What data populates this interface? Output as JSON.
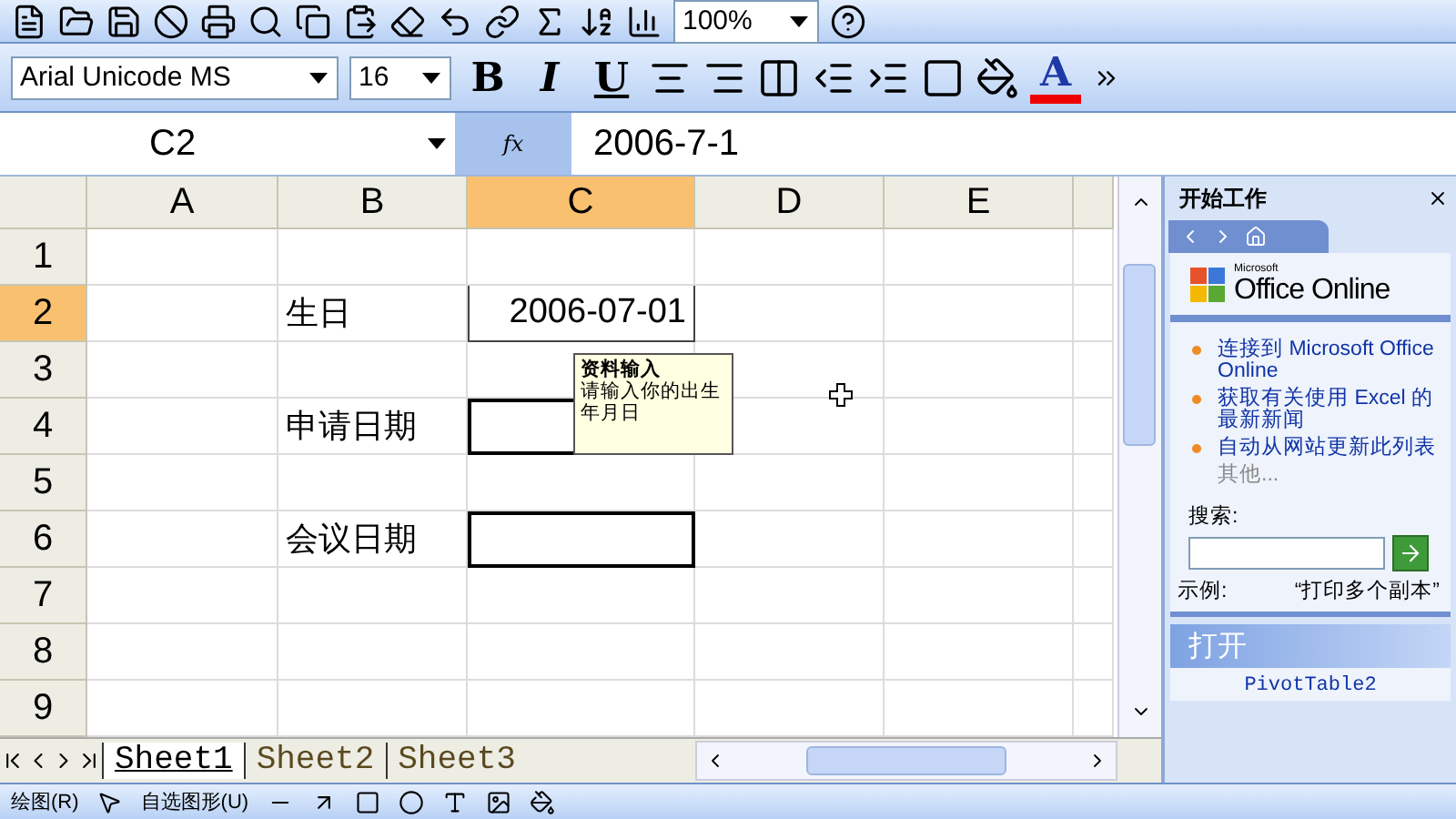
{
  "standard_toolbar": {
    "zoom": "100%"
  },
  "format_toolbar": {
    "font": "Arial Unicode MS",
    "size": "16",
    "bold": "B",
    "italic": "I",
    "underline": "U",
    "font_color": "A"
  },
  "formula_bar": {
    "name_box": "C2",
    "fx": "fx",
    "value": "2006-7-1"
  },
  "sheet": {
    "columns": [
      {
        "label": "A",
        "selected": false
      },
      {
        "label": "B",
        "selected": false
      },
      {
        "label": "C",
        "selected": true
      },
      {
        "label": "D",
        "selected": false
      },
      {
        "label": "E",
        "selected": false
      }
    ],
    "rows": [
      {
        "label": "1",
        "selected": false,
        "cells": [
          {
            "kind": "empty"
          },
          {
            "kind": "empty"
          },
          {
            "kind": "empty"
          },
          {
            "kind": "empty"
          },
          {
            "kind": "empty"
          }
        ]
      },
      {
        "label": "2",
        "selected": true,
        "cells": [
          {
            "kind": "empty"
          },
          {
            "kind": "plain",
            "text": "生日"
          },
          {
            "kind": "active",
            "text": "2006-07-01"
          },
          {
            "kind": "empty"
          },
          {
            "kind": "empty"
          }
        ]
      },
      {
        "label": "3",
        "selected": false,
        "cells": [
          {
            "kind": "empty"
          },
          {
            "kind": "empty"
          },
          {
            "kind": "empty"
          },
          {
            "kind": "empty"
          },
          {
            "kind": "empty"
          }
        ]
      },
      {
        "label": "4",
        "selected": false,
        "cells": [
          {
            "kind": "empty"
          },
          {
            "kind": "plain",
            "text": "申请日期"
          },
          {
            "kind": "boxed"
          },
          {
            "kind": "empty"
          },
          {
            "kind": "empty"
          }
        ]
      },
      {
        "label": "5",
        "selected": false,
        "cells": [
          {
            "kind": "empty"
          },
          {
            "kind": "empty"
          },
          {
            "kind": "empty"
          },
          {
            "kind": "empty"
          },
          {
            "kind": "empty"
          }
        ]
      },
      {
        "label": "6",
        "selected": false,
        "cells": [
          {
            "kind": "empty"
          },
          {
            "kind": "plain",
            "text": "会议日期"
          },
          {
            "kind": "boxed"
          },
          {
            "kind": "empty"
          },
          {
            "kind": "empty"
          }
        ]
      },
      {
        "label": "7",
        "selected": false,
        "cells": [
          {
            "kind": "empty"
          },
          {
            "kind": "empty"
          },
          {
            "kind": "empty"
          },
          {
            "kind": "empty"
          },
          {
            "kind": "empty"
          }
        ]
      },
      {
        "label": "8",
        "selected": false,
        "cells": [
          {
            "kind": "empty"
          },
          {
            "kind": "empty"
          },
          {
            "kind": "empty"
          },
          {
            "kind": "empty"
          },
          {
            "kind": "empty"
          }
        ]
      },
      {
        "label": "9",
        "selected": false,
        "cells": [
          {
            "kind": "empty"
          },
          {
            "kind": "empty"
          },
          {
            "kind": "empty"
          },
          {
            "kind": "empty"
          },
          {
            "kind": "empty"
          }
        ]
      }
    ],
    "comment": {
      "title": "资料输入",
      "text": "请输入你的出生年月日"
    }
  },
  "sheet_tabs": [
    {
      "label": "Sheet1",
      "selected": true
    },
    {
      "label": "Sheet2",
      "selected": false
    },
    {
      "label": "Sheet3",
      "selected": false
    }
  ],
  "task_pane": {
    "title": "开始工作",
    "logo_small": "Microsoft",
    "logo": "Office Online",
    "links": [
      {
        "text": "连接到 Microsoft Office Online",
        "disabled": false
      },
      {
        "text": "获取有关使用 Excel 的最新新闻",
        "disabled": false
      },
      {
        "text": "自动从网站更新此列表",
        "disabled": false
      }
    ],
    "more": "其他...",
    "search_label": "搜索:",
    "example_label": "示例:",
    "example": "“打印多个副本”",
    "open_heading": "打开",
    "open_items": [
      "PivotTable2"
    ]
  },
  "drawing_toolbar": {
    "draw_menu": "绘图(R)",
    "autoshapes_menu": "自选图形(U)"
  }
}
